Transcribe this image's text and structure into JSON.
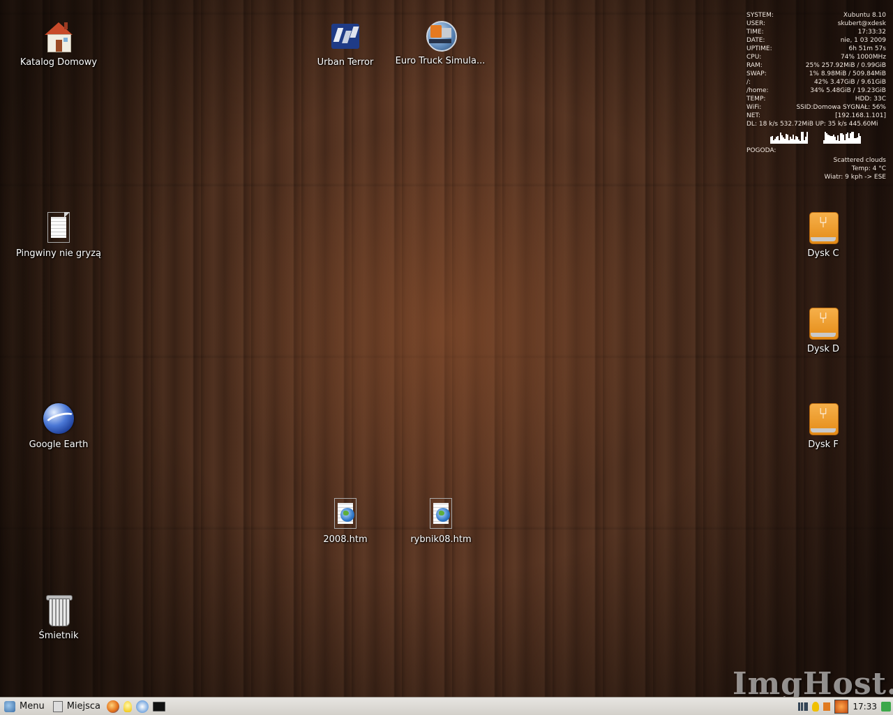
{
  "desktop": {
    "icons": {
      "home": "Katalog Domowy",
      "urban_terror": "Urban Terror",
      "euro_truck": "Euro Truck Simula...",
      "text_doc": "Pingwiny nie gryzą",
      "google_earth": "Google Earth",
      "file_2008": "2008.htm",
      "file_rybnik": "rybnik08.htm",
      "trash": "Śmietnik",
      "disk_c": "Dysk C",
      "disk_d": "Dysk D",
      "disk_f": "Dysk F"
    }
  },
  "conky": {
    "system_k": "SYSTEM:",
    "system_v": "Xubuntu 8.10",
    "user_k": "USER:",
    "user_v": "skubert@xdesk",
    "time_k": "TIME:",
    "time_v": "17:33:32",
    "date_k": "DATE:",
    "date_v": "nie,  1 03 2009",
    "uptime_k": "UPTIME:",
    "uptime_v": "6h 51m 57s",
    "cpu_k": "CPU:",
    "cpu_v": "74% 1000MHz",
    "ram_k": "RAM:",
    "ram_v": "25% 257.92MiB / 0.99GiB",
    "swap_k": "SWAP:",
    "swap_v": "1% 8.98MiB / 509.84MiB",
    "root_k": "/:",
    "root_v": "42% 3.47GiB / 9.61GiB",
    "home_k": "/home:",
    "home_v": "34% 5.48GiB / 19.23GiB",
    "temp_k": "TEMP:",
    "temp_v": "HDD: 33C",
    "wifi_k": "WiFi:",
    "wifi_v": "SSID:Domowa SYGNAŁ: 56%",
    "net_k": "NET:",
    "net_v": "[192.168.1.101]",
    "dlup": "DL: 18 k/s 532.72MiB UP: 35 k/s 445.60Mi",
    "pogoda_k": "POGODA:",
    "weather_desc": "Scattered clouds",
    "weather_temp": "Temp: 4 °C",
    "weather_wind": "Wiatr: 9 kph -> ESE"
  },
  "panel": {
    "menu_label": "Menu",
    "places_label": "Miejsca",
    "clock": "17:33"
  },
  "watermark": "ImgHost.pl",
  "colors": {
    "wood_dark": "#2c1a10",
    "wood_mid": "#5a3522",
    "panel_bg": "#d9d6d0",
    "usb_orange": "#e48b16"
  }
}
